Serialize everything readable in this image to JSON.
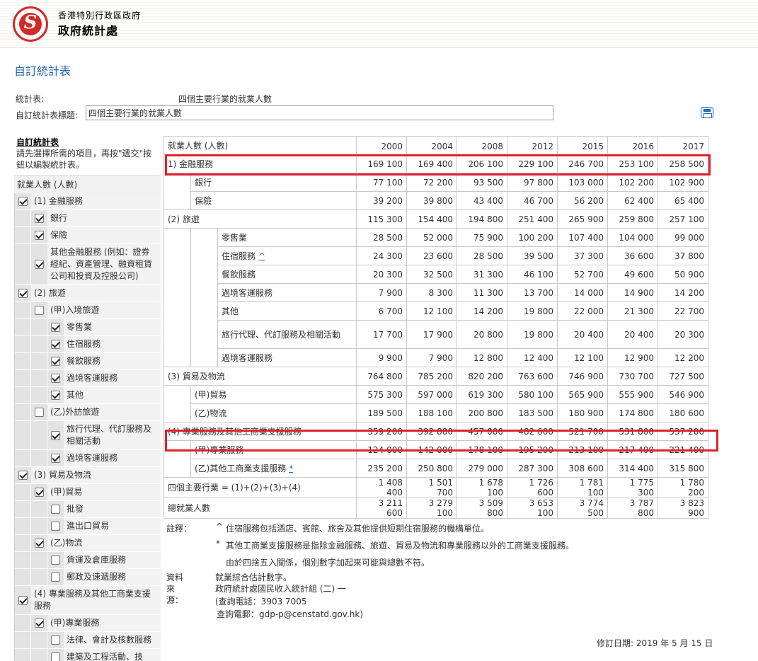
{
  "header": {
    "dept_top": "香港特別行政區政府",
    "dept_main": "政府統計處"
  },
  "page_title": "自訂統計表",
  "form": {
    "table_label": "統計表:",
    "table_value": "四個主要行業的就業人數",
    "title_label": "自訂統計表標題:",
    "title_value": "四個主要行業的就業人數"
  },
  "icons": {
    "print": "printer-icon",
    "logo": "csd-logo-icon"
  },
  "sidebar": {
    "heading": "自訂統計表",
    "instruction": "請先選擇所需的項目，再按\"遞交\"按鈕以編製統計表。",
    "category": "就業人數 (人數)",
    "items": [
      {
        "label": "(1) 金融服務",
        "depth": 0,
        "checked": true
      },
      {
        "label": "銀行",
        "depth": 1,
        "checked": true
      },
      {
        "label": "保險",
        "depth": 1,
        "checked": true
      },
      {
        "label": "其他金融服務 (例如：證券經紀、資產管理、融資租賃公司和投資及控股公司)",
        "depth": 1,
        "checked": true
      },
      {
        "label": "(2) 旅遊",
        "depth": 0,
        "checked": true
      },
      {
        "label": "(甲)入境旅遊",
        "depth": 1,
        "checked": false
      },
      {
        "label": "零售業",
        "depth": 2,
        "checked": true
      },
      {
        "label": "住宿服務",
        "depth": 2,
        "checked": true
      },
      {
        "label": "餐飲服務",
        "depth": 2,
        "checked": true
      },
      {
        "label": "過境客運服務",
        "depth": 2,
        "checked": true
      },
      {
        "label": "其他",
        "depth": 2,
        "checked": true
      },
      {
        "label": "(乙)外訪旅遊",
        "depth": 1,
        "checked": false
      },
      {
        "label": "旅行代理、代訂服務及相關活動",
        "depth": 2,
        "checked": true
      },
      {
        "label": "過境客運服務",
        "depth": 2,
        "checked": true
      },
      {
        "label": "(3) 貿易及物流",
        "depth": 0,
        "checked": true
      },
      {
        "label": "(甲)貿易",
        "depth": 1,
        "checked": true
      },
      {
        "label": "批發",
        "depth": 2,
        "checked": false
      },
      {
        "label": "進出口貿易",
        "depth": 2,
        "checked": false
      },
      {
        "label": "(乙)物流",
        "depth": 1,
        "checked": true
      },
      {
        "label": "貨運及倉庫服務",
        "depth": 2,
        "checked": false
      },
      {
        "label": "郵政及速遞服務",
        "depth": 2,
        "checked": false
      },
      {
        "label": "(4) 專業服務及其他工商業支援服務",
        "depth": 0,
        "checked": true
      },
      {
        "label": "(甲)專業服務",
        "depth": 1,
        "checked": true
      },
      {
        "label": "法律、會計及核數服務",
        "depth": 2,
        "checked": false
      },
      {
        "label": "建築及工程活動、技",
        "depth": 2,
        "checked": false
      }
    ]
  },
  "table": {
    "header_label": "就業人數 (人數)",
    "years": [
      "2000",
      "2004",
      "2008",
      "2012",
      "2015",
      "2016",
      "2017"
    ],
    "rows": [
      {
        "label": "1) 金融服務",
        "level": 0,
        "values": [
          "169 100",
          "169 400",
          "206 100",
          "229 100",
          "246 700",
          "253 100",
          "258 500"
        ]
      },
      {
        "label": "銀行",
        "level": 1,
        "values": [
          "77 100",
          "72 200",
          "93 500",
          "97 800",
          "103 000",
          "102 200",
          "102 900"
        ]
      },
      {
        "label": "保險",
        "level": 1,
        "values": [
          "39 200",
          "39 800",
          "43 400",
          "46 700",
          "56 200",
          "62 400",
          "65 400"
        ]
      },
      {
        "label": "(2) 旅遊",
        "level": 0,
        "values": [
          "115 300",
          "154 400",
          "194 800",
          "251 400",
          "265 900",
          "259 800",
          "257 100"
        ]
      },
      {
        "label": "零售業",
        "level": 2,
        "values": [
          "28 500",
          "52 000",
          "75 900",
          "100 200",
          "107 400",
          "104 000",
          "99 000"
        ]
      },
      {
        "label": "住宿服務",
        "mark": "^",
        "level": 2,
        "values": [
          "24 300",
          "23 600",
          "28 500",
          "39 500",
          "37 300",
          "36 600",
          "37 800"
        ]
      },
      {
        "label": "餐飲服務",
        "level": 2,
        "values": [
          "20 300",
          "32 500",
          "31 300",
          "46 100",
          "52 700",
          "49 600",
          "50 900"
        ]
      },
      {
        "label": "過境客運服務",
        "level": 2,
        "values": [
          "7 900",
          "8 300",
          "11 300",
          "13 700",
          "14 000",
          "14 900",
          "14 200"
        ]
      },
      {
        "label": "其他",
        "level": 2,
        "values": [
          "6 700",
          "12 100",
          "14 200",
          "19 800",
          "22 000",
          "21 300",
          "22 700"
        ]
      },
      {
        "label": "旅行代理、代訂服務及相關活動",
        "level": 2,
        "values": [
          "17 700",
          "17 900",
          "20 800",
          "19 800",
          "20 400",
          "20 400",
          "20 300"
        ]
      },
      {
        "label": "過境客運服務",
        "level": 2,
        "values": [
          "9 900",
          "7 900",
          "12 800",
          "12 400",
          "12 100",
          "12 900",
          "12 200"
        ]
      },
      {
        "label": "(3) 貿易及物流",
        "level": 0,
        "values": [
          "764 800",
          "785 200",
          "820 200",
          "763 600",
          "746 900",
          "730 700",
          "727 500"
        ]
      },
      {
        "label": "(甲)貿易",
        "level": 1,
        "values": [
          "575 300",
          "597 000",
          "619 300",
          "580 100",
          "565 900",
          "555 900",
          "546 900"
        ]
      },
      {
        "label": "(乙)物流",
        "level": 1,
        "values": [
          "189 500",
          "188 100",
          "200 800",
          "183 500",
          "180 900",
          "174 800",
          "180 600"
        ]
      },
      {
        "label": "(4) 專業服務及其他工商業支援服務",
        "level": 0,
        "values": [
          "359 200",
          "392 800",
          "457 000",
          "482 600",
          "521 700",
          "531 800",
          "537 200"
        ]
      },
      {
        "label": "(甲)專業服務",
        "level": 1,
        "values": [
          "124 000",
          "142 000",
          "178 100",
          "195 200",
          "213 100",
          "217 400",
          "221 400"
        ]
      },
      {
        "label": "(乙)其他工商業支援服務",
        "mark": "*",
        "level": 1,
        "values": [
          "235 200",
          "250 800",
          "279 000",
          "287 300",
          "308 600",
          "314 400",
          "315 800"
        ]
      },
      {
        "label": "四個主要行業 = (1)+(2)+(3)+(4)",
        "level": 0,
        "values": [
          "1 408 400",
          "1 501 700",
          "1 678 100",
          "1 726 600",
          "1 781 100",
          "1 775 300",
          "1 780 200"
        ]
      },
      {
        "label": "總就業人數",
        "level": 0,
        "values": [
          "3 211 600",
          "3 279 100",
          "3 509 800",
          "3 653 100",
          "3 774 500",
          "3 787 800",
          "3 823 900"
        ]
      }
    ]
  },
  "notes": {
    "label": "註釋：",
    "items": [
      {
        "mark": "^",
        "text": "住宿服務包括酒店、賓館、旅舍及其他提供短期住宿服務的機構單位。"
      },
      {
        "mark": "*",
        "text": "其他工商業支援服務是指除金融服務、旅遊、貿易及物流和專業服務以外的工商業支援服務。"
      },
      {
        "mark": "",
        "text": "由於四捨五入關係，個別數字加起來可能與總數不符。"
      }
    ]
  },
  "source": {
    "label": "資料來源：",
    "lines": [
      "就業綜合估計數字。",
      "政府統計處國民收入統計組 (二) 一",
      "(查詢電話：3903 7005",
      "查詢電郵：gdp-p@censtatd.gov.hk)"
    ]
  },
  "revision": "修訂日期: 2019 年 5 月 15 日"
}
